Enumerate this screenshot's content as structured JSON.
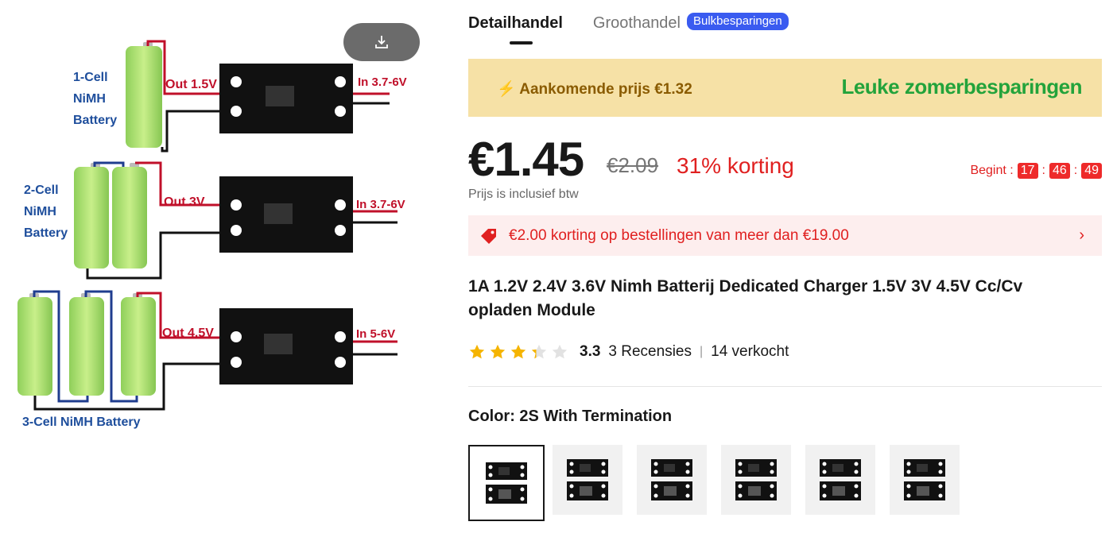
{
  "diagram": {
    "groups": [
      {
        "battery_label": [
          "1-Cell",
          "NiMH",
          "Battery"
        ],
        "out_label": "Out 1.5V",
        "in_label": "In 3.7-6V"
      },
      {
        "battery_label": [
          "2-Cell",
          "NiMH",
          "Battery"
        ],
        "out_label": "Out 3V",
        "in_label": "In 3.7-6V"
      },
      {
        "battery_label": [
          "3-Cell NiMH Battery"
        ],
        "out_label": "Out 4.5V",
        "in_label": "In 5-6V"
      }
    ]
  },
  "tabs": {
    "active": "Detailhandel",
    "inactive": "Groothandel",
    "badge": "Bulkbesparingen"
  },
  "banner": {
    "upcoming": "Aankomende prijs €1.32",
    "promo": "Leuke zomerbesparingen"
  },
  "price": {
    "current": "€1.45",
    "original": "€2.09",
    "discount": "31% korting",
    "tax_note": "Prijs is inclusief btw"
  },
  "countdown": {
    "label": "Begint :",
    "hours": "17",
    "minutes": "46",
    "seconds": "49"
  },
  "coupon": {
    "text": "€2.00 korting op bestellingen van meer dan €19.00"
  },
  "product": {
    "title": "1A 1.2V 2.4V 3.6V Nimh Batterij Dedicated Charger 1.5V 3V 4.5V Cc/Cv opladen Module"
  },
  "rating": {
    "value": "3.3",
    "stars": 3.3,
    "reviews": "3 Recensies",
    "sold": "14 verkocht"
  },
  "color": {
    "label": "Color: 2S With Termination",
    "option_count": 6
  },
  "colors": {
    "accent_red": "#e02020",
    "banner_bg": "#f6e1a6",
    "promo_green": "#23a33b",
    "badge_blue": "#3a5bf0",
    "star": "#f5b400"
  }
}
